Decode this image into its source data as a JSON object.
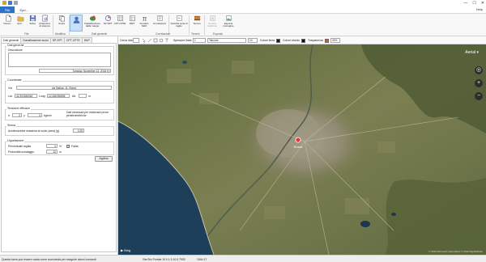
{
  "titlebar": {
    "buttons": [
      "minimize",
      "maximize",
      "close"
    ],
    "glyphs": {
      "minimize": "—",
      "maximize": "☐",
      "close": "✕"
    }
  },
  "tabs": [
    {
      "label": "File",
      "active": true
    },
    {
      "label": "Epri...",
      "active": false
    }
  ],
  "help_label": "Help",
  "ribbon": {
    "buttons": [
      {
        "label": "Nuovo...",
        "icon": "new-file-icon"
      },
      {
        "label": "Apri...",
        "icon": "open-folder-icon"
      },
      {
        "label": "Salva",
        "icon": "save-icon"
      },
      {
        "label": "Anteprima di stampa",
        "icon": "print-preview-icon"
      },
      {
        "label": "Copia",
        "icon": "copy-icon"
      },
      {
        "label": "",
        "icon": "user-settings-icon",
        "selected": true
      },
      {
        "label": "Classificazione dalla mappa",
        "icon": "map-classification-icon"
      },
      {
        "label": "SP-SPT",
        "icon": "chart-sp-spt-icon"
      },
      {
        "label": "CPT-CPTE",
        "icon": "grid-cpt-icon"
      },
      {
        "label": "DMT",
        "icon": "grid-dmt-icon"
      },
      {
        "label": "Fondulo SEO",
        "icon": "pi-icon"
      },
      {
        "label": "Correlazioni",
        "icon": "correlation-icon"
      },
      {
        "label": "Velocità onde di taglio",
        "icon": "shear-wave-icon"
      },
      {
        "label": "Terreni",
        "icon": "terrain-icon"
      },
      {
        "label": "Genera relazione",
        "icon": "report-icon",
        "disabled": true
      },
      {
        "label": "Esporta immagine",
        "icon": "export-image-icon"
      }
    ],
    "groups": [
      "File",
      "Modifica",
      "Dati generali",
      "Correlazioni",
      "Terreni",
      "Esporta"
    ]
  },
  "left_tabs": [
    {
      "label": "Dati generali",
      "active": true
    },
    {
      "label": "Classificazione suolo",
      "active": false
    },
    {
      "label": "SP-SPT",
      "active": false
    },
    {
      "label": "CPT-CPTE",
      "active": false
    },
    {
      "label": "DMT",
      "active": false
    }
  ],
  "form": {
    "general": {
      "title": "Dati generali",
      "description_label": "Descrizione",
      "date_day": "Tuesday",
      "date_rest": ", November 13, 2018"
    },
    "coords": {
      "title": "Coordinate",
      "via_label": "Via",
      "via_value": "via Sistina, 11, Roma",
      "lat_label": "Lat.",
      "lat_value": "41.902636962",
      "long_label": "Long.",
      "long_value": "12.486786896",
      "alt_label": "Alt.",
      "alt_value": "m"
    },
    "tension": {
      "title": "Tensione efficace",
      "sigma_label": "σ",
      "sigma_value": "0",
      "gamma_label": "γ",
      "gamma_value": "0",
      "unit": "kg/cm²",
      "note": "Dati necessari per elaborare prove penetrometriche"
    },
    "sisma": {
      "title": "Sisma",
      "acc_label": "Accelerazione massima al suolo (ama) (g)",
      "acc_value": "0.25"
    },
    "liquefaction": {
      "title": "Liquefazione",
      "perc_label": "Percentuale argilla",
      "perc_value": "0",
      "perc_unit": "%",
      "falda_label": "Falda",
      "falda_checked": true,
      "depth_label": "Profondità sondaggio",
      "depth_value": "10",
      "depth_unit": "m"
    },
    "apply_label": "Applica"
  },
  "map_toolbar": {
    "cerca_label": "Cerca vista",
    "spessore_label": "Spessore linea",
    "spessore_value": "1",
    "tahoma_value": "Tahoma",
    "font_size_value": "10",
    "colore_linea_label": "Colore linea",
    "colore_linea_color": "#1c1c1c",
    "colore_sfondo_label": "Colore sfondo",
    "colore_sfondo_color": "#111111",
    "trasparenza_label": "Trasparenza",
    "trasparenza_color": "#e05a1e",
    "trasparenza_value": "40%"
  },
  "map": {
    "aerial_label": "Aerial",
    "bing_label": "Bing",
    "marker_label": "Roma",
    "attrib": "© 2019 Microsoft Corporation © 2019 DigitalGlobe"
  },
  "status": {
    "left": "Questa barra può essere usata come scorciatoia per eseguire alcuni comandi",
    "mid": "GeoTec Portale 10.0.1.3   10.0.7953",
    "right": "1944-17"
  },
  "colors": {
    "accent": "#2b73c8",
    "map_land": "#6f7a4c",
    "map_sea": "#1d3f5a"
  }
}
